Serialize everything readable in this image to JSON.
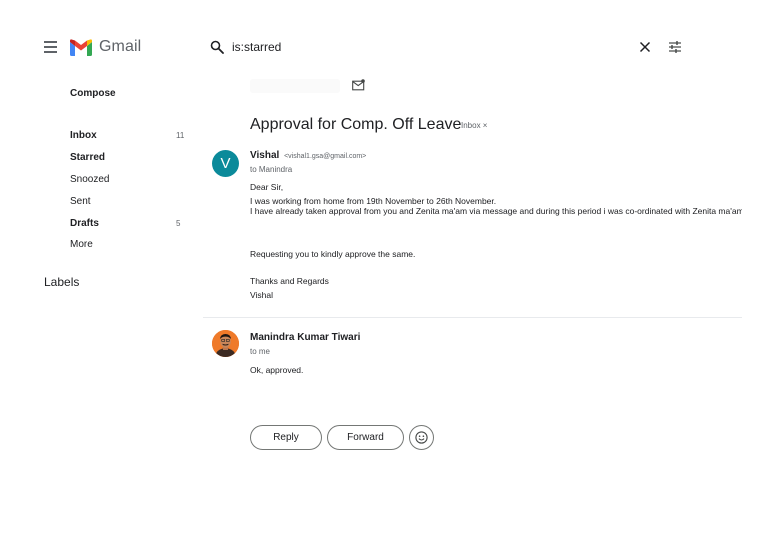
{
  "app": {
    "name": "Gmail"
  },
  "search": {
    "value": "is:starred"
  },
  "sidebar": {
    "compose_label": "Compose",
    "items": [
      {
        "label": "Inbox",
        "count": "11",
        "bold": true
      },
      {
        "label": "Starred",
        "count": "",
        "bold": true
      },
      {
        "label": "Snoozed",
        "count": "",
        "bold": false
      },
      {
        "label": "Sent",
        "count": "",
        "bold": false
      },
      {
        "label": "Drafts",
        "count": "5",
        "bold": true
      },
      {
        "label": "More",
        "count": "",
        "bold": false
      }
    ],
    "labels_heading": "Labels"
  },
  "thread": {
    "subject": "Approval for Comp. Off Leave",
    "label_badge": "Inbox ×",
    "messages": [
      {
        "avatar_letter": "V",
        "sender_name": "Vishal",
        "sender_email": "<vishal1.gsa@gmail.com>",
        "to": "to Manindra",
        "body": {
          "greeting": "Dear Sir,",
          "line1": "I was working from home from 19th November to 26th November.",
          "line2": "I have already taken approval from you and Zenita ma'am via message and during this period i was co-ordinated with Zenita ma'am",
          "line3": "Requesting you to kindly approve the same.",
          "signoff": "Thanks and Regards",
          "signature": "Vishal"
        }
      },
      {
        "sender_name": "Manindra Kumar Tiwari",
        "to": "to me",
        "body": "Ok, approved."
      }
    ]
  },
  "actions": {
    "reply_label": "Reply",
    "forward_label": "Forward"
  },
  "colors": {
    "avatar_v": "#0b8a9a",
    "gmail_red": "#ea4335",
    "gmail_blue": "#4285f4",
    "gmail_green": "#34a853",
    "gmail_yellow": "#fbbc04"
  },
  "icons": [
    "menu-icon",
    "gmail-logo-icon",
    "search-icon",
    "clear-icon",
    "tune-icon",
    "mail-icon",
    "emoji-icon"
  ]
}
